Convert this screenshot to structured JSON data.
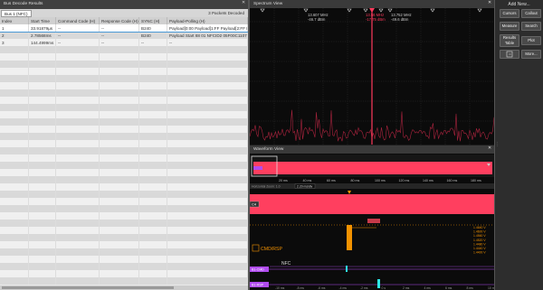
{
  "bus_panel": {
    "title": "Bus Decode Results",
    "close": "✕",
    "tab": "Bus 1 (NFC)",
    "packets_decoded": "3 Packets Decoded",
    "columns": [
      "Index",
      "Start Time",
      "Command Code (H)",
      "Response Code (H)",
      "SYNC (H)",
      "Payload-Polling (H)"
    ],
    "rows": [
      [
        "1",
        "33.91879µs",
        "--",
        "--",
        "B240",
        "Payload[0:00 Payload[1:FF Payload[2:FF Paylo"
      ],
      [
        "2",
        "2.78568ms",
        "--",
        "--",
        "B240",
        "Payload Start 88 01 NFCID2 05F00C1107E"
      ],
      [
        "3",
        "144.4999ms",
        "--",
        "--",
        "--",
        "--"
      ]
    ]
  },
  "spectrum": {
    "title": "Spectrum View",
    "close": "✕",
    "marker_left_freq": "13.607 MHz",
    "marker_left_level": "-46.7 dBm",
    "marker_peak_freq": "13.56 MHz",
    "marker_peak_level": "-17.75 dBm",
    "marker_right_freq": "13.752 MHz",
    "marker_right_level": "-49.6 dBm"
  },
  "waveform": {
    "title": "Waveform View",
    "close": "✕",
    "time_ticks": [
      "20 ms",
      "40 ms",
      "60 ms",
      "80 ms",
      "100 ms",
      "120 ms",
      "140 ms",
      "160 ms",
      "180 ms"
    ],
    "zoom_label": "Horizontal Zoom: 1.0",
    "zoom_value": "2.20 ms/div",
    "c4_label": "C4",
    "cmd_rsp_label": "CMD/RSP",
    "nfc_label": "NFC",
    "b1_cmd_label": "B1-CMD",
    "b1_rsp_label": "B1-RSP",
    "right_values": [
      "1.4640 V",
      "1.4600 V",
      "1.4560 V",
      "1.4520 V",
      "1.4480 V",
      "1.4440 V",
      "1.4400 V"
    ],
    "bottom_ticks": [
      "-10 ms",
      "-8 ms",
      "-6 ms",
      "-4 ms",
      "-2 ms",
      "0 s",
      "2 ms",
      "4 ms",
      "6 ms",
      "8 ms",
      "10 ms"
    ]
  },
  "sidebar": {
    "title": "Add New...",
    "buttons": [
      "Cursors",
      "Callout",
      "Measure",
      "Search",
      "Results Table",
      "Plot",
      "",
      "More..."
    ]
  },
  "colors": {
    "accent": "#ff3a5c",
    "orange": "#f39200",
    "purple": "#b14cf0",
    "cyan": "#2ee6e6"
  }
}
